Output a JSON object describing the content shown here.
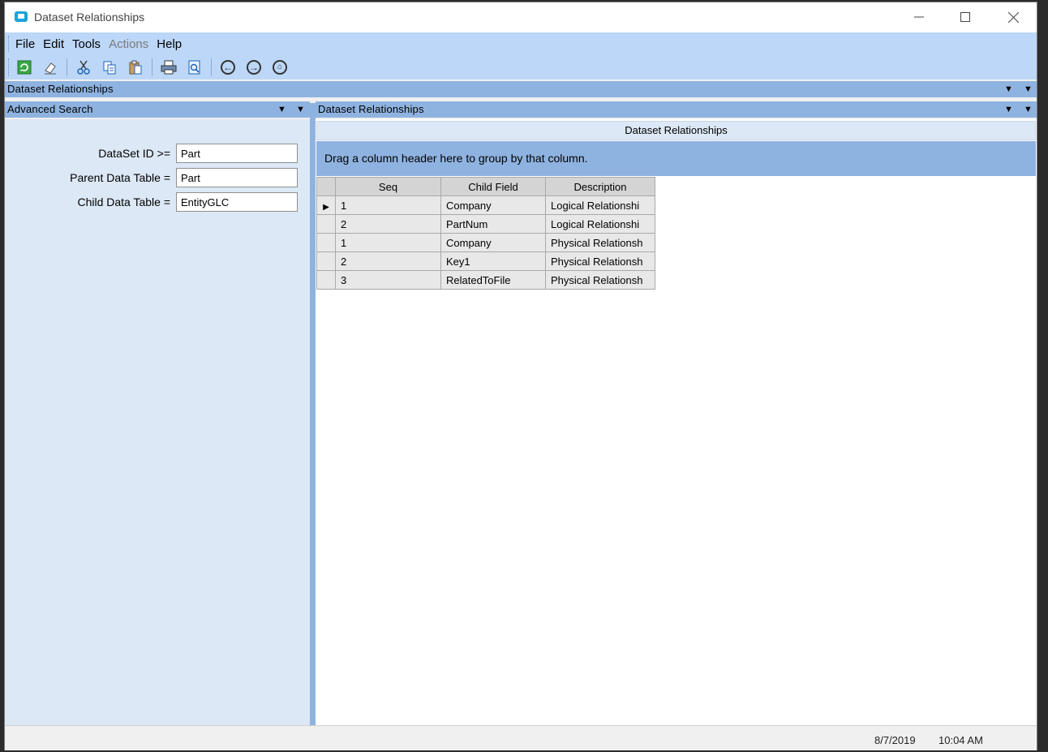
{
  "window": {
    "title": "Dataset Relationships"
  },
  "menu": {
    "file": "File",
    "edit": "Edit",
    "tools": "Tools",
    "actions": "Actions",
    "help": "Help"
  },
  "toolbar": {
    "icons": [
      "refresh-icon",
      "clear-icon",
      "cut-icon",
      "copy-icon",
      "paste-icon",
      "print-icon",
      "print-preview-icon",
      "back-icon",
      "forward-icon",
      "home-icon"
    ]
  },
  "dock": {
    "main_title": "Dataset Relationships",
    "advanced_search_title": "Advanced Search",
    "grid_panel_title": "Dataset Relationships"
  },
  "search": {
    "dataset_id_label": "DataSet ID >=",
    "dataset_id_value": "Part",
    "parent_table_label": "Parent Data Table =",
    "parent_table_value": "Part",
    "child_table_label": "Child Data Table =",
    "child_table_value": "EntityGLC"
  },
  "grid": {
    "caption": "Dataset Relationships",
    "group_hint": "Drag a column header here to group by that column.",
    "columns": [
      "Seq",
      "Child Field",
      "Description"
    ],
    "rows": [
      {
        "seq": "1",
        "child_field": "Company",
        "description": "Logical Relationshi"
      },
      {
        "seq": "2",
        "child_field": "PartNum",
        "description": "Logical Relationshi"
      },
      {
        "seq": "1",
        "child_field": "Company",
        "description": "Physical Relationsh"
      },
      {
        "seq": "2",
        "child_field": "Key1",
        "description": "Physical Relationsh"
      },
      {
        "seq": "3",
        "child_field": "RelatedToFile",
        "description": "Physical Relationsh"
      }
    ]
  },
  "status": {
    "date": "8/7/2019",
    "time": "10:04 AM"
  },
  "colors": {
    "accent": "#8fb3e0",
    "menubar": "#bcd7f7",
    "panel": "#dce8f5"
  }
}
